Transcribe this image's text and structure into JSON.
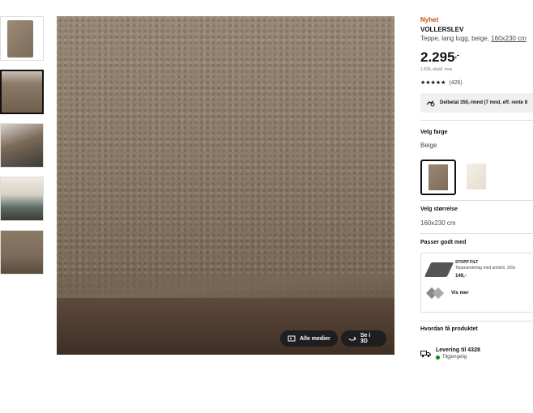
{
  "thumbnails": [
    "thumbnail-1",
    "thumbnail-2",
    "thumbnail-3",
    "thumbnail-4",
    "thumbnail-5"
  ],
  "main_image": {
    "all_media_label": "Alle medier",
    "view_3d_label": "Se i 3D"
  },
  "product": {
    "badge": "Nyhet",
    "name": "VOLLERSLEV",
    "description_prefix": "Teppe, lang lugg, beige, ",
    "size_link": "160x230 cm",
    "price_main": "2.295",
    "price_suffix": ",-",
    "price_ex_vat": "1.836,-ekskl. mva",
    "stars": "★★★★★",
    "review_count": "(426)",
    "financing_text": "Delbetal 350,-/mnd (7 mnd, eff. rente 8"
  },
  "color": {
    "label": "Velg farge",
    "selected": "Beige",
    "options": [
      "beige",
      "white"
    ]
  },
  "size": {
    "label": "Velg størrelse",
    "selected": "160x230 cm"
  },
  "accessories": {
    "label": "Passer godt med",
    "item_name": "STOPP FILT",
    "item_desc": "Teppeunderlag med antiskli, 165x",
    "item_price": "149,-",
    "see_more": "Vis mer"
  },
  "delivery": {
    "label": "Hvordan få produktet",
    "title": "Levering til 4328",
    "status": "Tilgjengelig"
  },
  "colors": {
    "badge": "#ca5008",
    "status_ok": "#0a8a00"
  }
}
